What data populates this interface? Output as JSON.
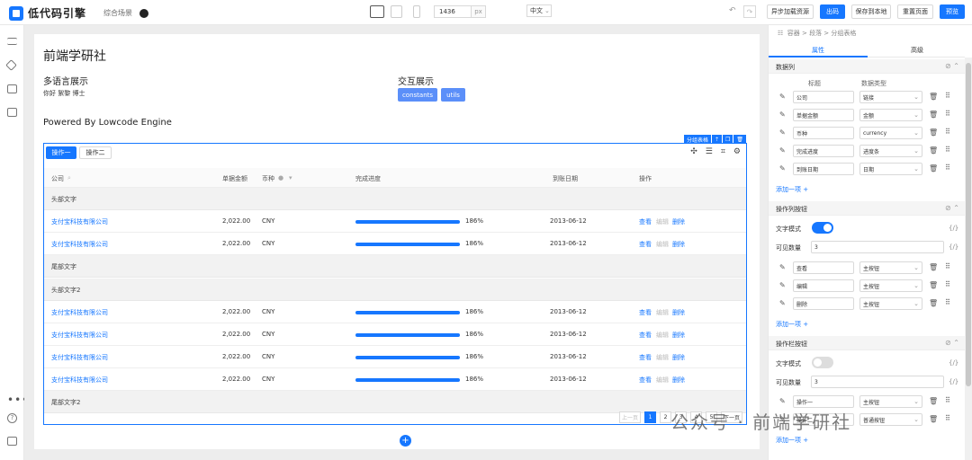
{
  "brand": {
    "name": "低代码引擎",
    "scene": "综合场景"
  },
  "toolbar": {
    "width_value": "1436",
    "width_unit": "px",
    "language": "中文",
    "buttons": [
      "异步加载资源",
      "出码",
      "保存到本地",
      "重置页面",
      "预览"
    ]
  },
  "page": {
    "title": "前端学研社",
    "multi_lang_title": "多语言展示",
    "multi_lang_text": "你好 絮黎 博士",
    "interact_title": "交互展示",
    "chip1": "constants",
    "chip2": "utils",
    "powered": "Powered By Lowcode Engine"
  },
  "table": {
    "tag": "分组表格",
    "action1": "操作一",
    "action2": "操作二",
    "columns": [
      "公司",
      "单据金额",
      "币种",
      "完成进度",
      "到账日期",
      "操作"
    ],
    "group1_header": "头部文字",
    "group1_footer": "尾部文字",
    "group2_header": "头部文字2",
    "group2_footer": "尾部文字2",
    "rows": [
      {
        "company": "支付宝科技有限公司",
        "amount": "2,022.00",
        "currency": "CNY",
        "progress": "186%",
        "date": "2013-06-12"
      },
      {
        "company": "支付宝科技有限公司",
        "amount": "2,022.00",
        "currency": "CNY",
        "progress": "186%",
        "date": "2013-06-12"
      },
      {
        "company": "支付宝科技有限公司",
        "amount": "2,022.00",
        "currency": "CNY",
        "progress": "186%",
        "date": "2013-06-12"
      },
      {
        "company": "支付宝科技有限公司",
        "amount": "2,022.00",
        "currency": "CNY",
        "progress": "186%",
        "date": "2013-06-12"
      },
      {
        "company": "支付宝科技有限公司",
        "amount": "2,022.00",
        "currency": "CNY",
        "progress": "186%",
        "date": "2013-06-12"
      },
      {
        "company": "支付宝科技有限公司",
        "amount": "2,022.00",
        "currency": "CNY",
        "progress": "186%",
        "date": "2013-06-12"
      }
    ],
    "ops": [
      "查看",
      "编辑",
      "删除"
    ],
    "pager": {
      "prev": "上一页",
      "pages": [
        "1",
        "2",
        "3",
        "4",
        "5"
      ],
      "next": "下一页"
    }
  },
  "panel": {
    "breadcrumb": [
      "容器",
      "段落",
      "分组表格"
    ],
    "tabs": [
      "属性",
      "高级"
    ],
    "sec_columns": "数据列",
    "col_header_title": "标题",
    "col_header_type": "数据类型",
    "columns": [
      {
        "title": "公司",
        "type": "链接"
      },
      {
        "title": "单据金额",
        "type": "金额"
      },
      {
        "title": "币种",
        "type": "currency"
      },
      {
        "title": "完成进度",
        "type": "进度条"
      },
      {
        "title": "到账日期",
        "type": "日期"
      }
    ],
    "add_item": "添加一项 +",
    "sec_op_col": "操作列按钮",
    "text_mode": "文字模式",
    "visible_count": "可见数量",
    "visible_value": "3",
    "op_col_buttons": [
      {
        "title": "查看",
        "type": "主按钮"
      },
      {
        "title": "编辑",
        "type": "主按钮"
      },
      {
        "title": "删除",
        "type": "主按钮"
      }
    ],
    "sec_op_bar": "操作栏按钮",
    "op_bar_buttons": [
      {
        "title": "操作一",
        "type": "主按钮"
      },
      {
        "title": "操作二",
        "type": "普通按钮"
      }
    ],
    "accent": "#1677ff"
  },
  "watermark": "公众号 · 前端学研社"
}
